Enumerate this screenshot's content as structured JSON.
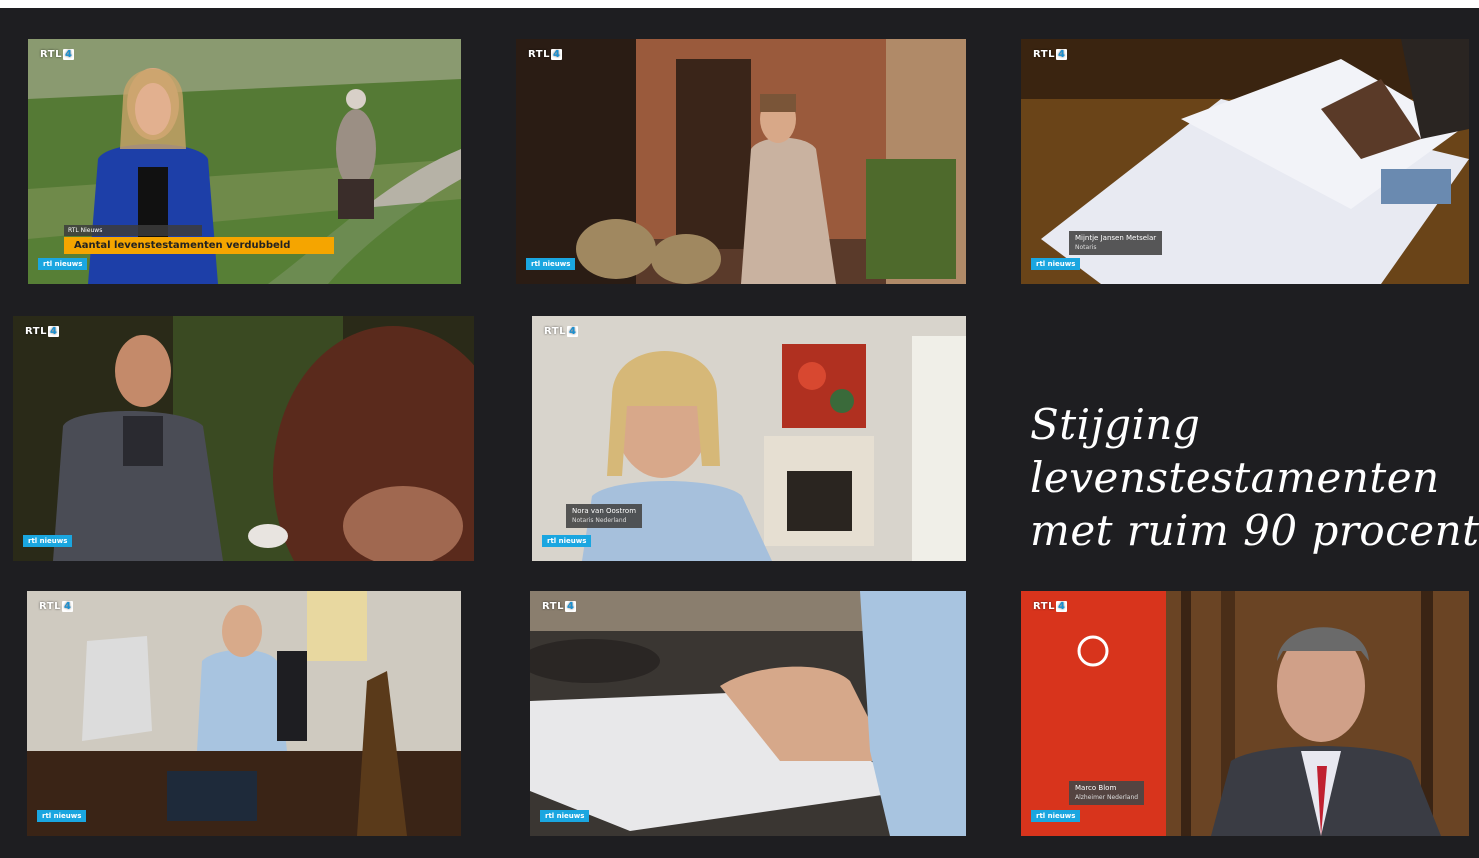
{
  "headline_lines": [
    "Stijging",
    "levenstestamenten",
    "met ruim 90 procent"
  ],
  "logo_text": "RTL",
  "logo_number": "4",
  "channel_badge": "rtl nieuws",
  "frames": [
    {
      "id": "presenter",
      "ticker_small": "RTL Nieuws",
      "ticker": "Aantal levenstestamenten verdubbeld"
    },
    {
      "id": "porch"
    },
    {
      "id": "documents",
      "lower_name": "Mijntje Jansen Metselar",
      "lower_sub": "Notaris"
    },
    {
      "id": "meeting"
    },
    {
      "id": "interview-woman",
      "lower_name": "Nora van Oostrom",
      "lower_sub": "Notaris Nederland"
    },
    {
      "id": "desk"
    },
    {
      "id": "keyboard"
    },
    {
      "id": "interview-man",
      "lower_name": "Marco Blom",
      "lower_sub": "Alzheimer Nederland"
    }
  ],
  "colors": {
    "background": "#1e1e21",
    "ticker": "#f5a500",
    "badge": "#1aa6e0",
    "headline": "#ffffff"
  }
}
